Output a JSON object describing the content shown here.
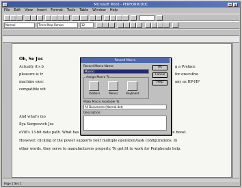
{
  "window": {
    "title": "Microsoft Word - PERFORM.DOC"
  },
  "menu": [
    "File",
    "Edit",
    "View",
    "Insert",
    "Format",
    "Tools",
    "Table",
    "Window",
    "Help"
  ],
  "toolbar2": {
    "style": "Normal",
    "font": "Times New Roman",
    "size": "12"
  },
  "document": {
    "heading": "Oh, Se Jus",
    "lines": [
      "Actually it's b",
      "pleasure is tr",
      "machine exec",
      "compatible wit",
      "And what's mo",
      "Ilya Sergeevich Jus",
      "eVill's 13-bit data path. What has reason to proceed without a Peripheral performance boost.",
      "However, clicking of the power supports your multiple operation/task configurations. In",
      "other words, they serve to manufacturers properly. To get fit to work for Peripherals help."
    ],
    "right_fragments": [
      "g a Preface",
      "for executive",
      "any as HP-HP"
    ]
  },
  "dialog": {
    "title": "Record Macro",
    "record_name_label": "Record Macro Name:",
    "record_name_value": "Macro1",
    "assign_label": "Assign Macro To",
    "assign_items": [
      "Toolbars",
      "Menus",
      "Keyboard"
    ],
    "available_label": "Make Macro Available To:",
    "available_value": "All Documents (Normal.dot)",
    "description_label": "Description:",
    "ok": "OK",
    "cancel": "Cancel",
    "help": "Help"
  },
  "status": {
    "text": "Page 1  Sec 1"
  }
}
